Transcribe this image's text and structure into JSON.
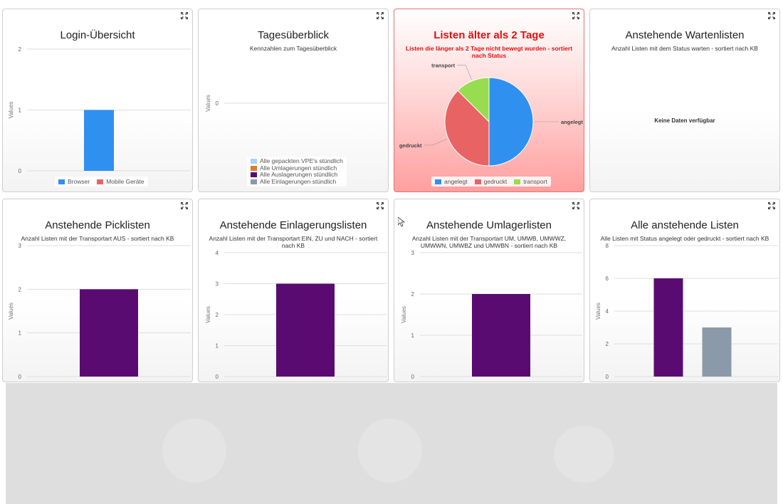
{
  "ui": {
    "expand_icon": "expand-arrows-icon",
    "y_axis_label": "Values",
    "no_data_text": "Keine Daten verfügbar"
  },
  "cards": [
    {
      "id": "login",
      "title": "Login-Übersicht",
      "subtitle": "",
      "chart_kind": "bar",
      "legend": [
        {
          "label": "Browser",
          "color": "#3090f0"
        },
        {
          "label": "Mobile Geräte",
          "color": "#e86464"
        }
      ]
    },
    {
      "id": "tages",
      "title": "Tagesüberblick",
      "subtitle": "Kennzahlen zum Tagesüberblick",
      "chart_kind": "bar-empty",
      "legend": [
        {
          "label": "Alle gepackten VPE's stündlich",
          "color": "#a8d4f5"
        },
        {
          "label": "Alle Umlagerungen stündlich",
          "color": "#e07b30"
        },
        {
          "label": "Alle Auslagerungen stündlich",
          "color": "#5a0b72"
        },
        {
          "label": "Alle Einlagerungen stündlich",
          "color": "#8a9aa8"
        }
      ]
    },
    {
      "id": "aelter",
      "title": "Listen älter als 2 Tage",
      "subtitle": "Listen die länger als 2 Tage nicht bewegt wurden - sortiert nach Status",
      "chart_kind": "pie",
      "legend": [
        {
          "label": "angelegt",
          "color": "#3090f0"
        },
        {
          "label": "gedruckt",
          "color": "#e86464"
        },
        {
          "label": "transport",
          "color": "#98dc50"
        }
      ]
    },
    {
      "id": "warte",
      "title": "Anstehende Wartenlisten",
      "subtitle": "Anzahl Listen mit dem Status warten - sortiert nach KB",
      "chart_kind": "nodata",
      "legend": []
    },
    {
      "id": "pick",
      "title": "Anstehende Picklisten",
      "subtitle": "Anzahl Listen mit der Transportart AUS - sortiert nach KB",
      "chart_kind": "bar",
      "legend": []
    },
    {
      "id": "einlager",
      "title": "Anstehende Einlagerungslisten",
      "subtitle": "Anzahl Listen mit der Transportart EIN, ZU und NACH - sortiert nach KB",
      "chart_kind": "bar",
      "legend": []
    },
    {
      "id": "umlager",
      "title": "Anstehende Umlagerlisten",
      "subtitle": "Anzahl Listen mit der Transportart UM, UMWB, UMWWZ, UMWWN, UMWBZ und UMWBN - sortiert nach KB",
      "chart_kind": "bar",
      "legend": []
    },
    {
      "id": "alle",
      "title": "Alle anstehende Listen",
      "subtitle": "Alle Listen mit Status angelegt oder gedruckt - sortiert nach KB",
      "chart_kind": "bar",
      "legend": []
    }
  ],
  "chart_data": [
    {
      "type": "bar",
      "title": "Login-Übersicht",
      "ylabel": "Values",
      "ylim": [
        0,
        2
      ],
      "yticks": [
        0,
        1,
        2
      ],
      "series": [
        {
          "name": "Browser",
          "color": "#3090f0",
          "values": [
            1
          ]
        },
        {
          "name": "Mobile Geräte",
          "color": "#e86464",
          "values": [
            0
          ]
        }
      ],
      "legend": "bottom"
    },
    {
      "type": "bar",
      "title": "Tagesüberblick",
      "ylabel": "Values",
      "ylim": [
        0,
        0
      ],
      "yticks": [
        0
      ],
      "series": [
        {
          "name": "Alle gepackten VPE's stündlich",
          "color": "#a8d4f5",
          "values": []
        },
        {
          "name": "Alle Umlagerungen stündlich",
          "color": "#e07b30",
          "values": []
        },
        {
          "name": "Alle Auslagerungen stündlich",
          "color": "#5a0b72",
          "values": []
        },
        {
          "name": "Alle Einlagerungen stündlich",
          "color": "#8a9aa8",
          "values": []
        }
      ],
      "legend": "bottom"
    },
    {
      "type": "pie",
      "title": "Listen älter als 2 Tage",
      "slices": [
        {
          "label": "angelegt",
          "value": 50,
          "color": "#3090f0"
        },
        {
          "label": "gedruckt",
          "value": 37.5,
          "color": "#e86464"
        },
        {
          "label": "transport",
          "value": 12.5,
          "color": "#98dc50"
        }
      ],
      "legend": "bottom"
    },
    {
      "type": "bar",
      "title": "Anstehende Wartenlisten",
      "series": []
    },
    {
      "type": "bar",
      "title": "Anstehende Picklisten",
      "ylabel": "Values",
      "ylim": [
        0,
        3
      ],
      "yticks": [
        0,
        1,
        2,
        3
      ],
      "series": [
        {
          "values": [
            2
          ],
          "color": "#5a0b72"
        }
      ]
    },
    {
      "type": "bar",
      "title": "Anstehende Einlagerungslisten",
      "ylabel": "Values",
      "ylim": [
        0,
        4
      ],
      "yticks": [
        0,
        1,
        2,
        3,
        4
      ],
      "series": [
        {
          "values": [
            3
          ],
          "color": "#5a0b72"
        }
      ]
    },
    {
      "type": "bar",
      "title": "Anstehende Umlagerlisten",
      "ylabel": "Values",
      "ylim": [
        0,
        3
      ],
      "yticks": [
        0,
        1,
        2,
        3
      ],
      "series": [
        {
          "values": [
            2
          ],
          "color": "#5a0b72"
        }
      ]
    },
    {
      "type": "bar",
      "title": "Alle anstehende Listen",
      "ylabel": "Values",
      "ylim": [
        0,
        8
      ],
      "yticks": [
        0,
        2,
        4,
        6,
        8
      ],
      "series": [
        {
          "values": [
            6
          ],
          "color": "#5a0b72"
        },
        {
          "values": [
            3
          ],
          "color": "#8a9aa8"
        }
      ]
    }
  ]
}
